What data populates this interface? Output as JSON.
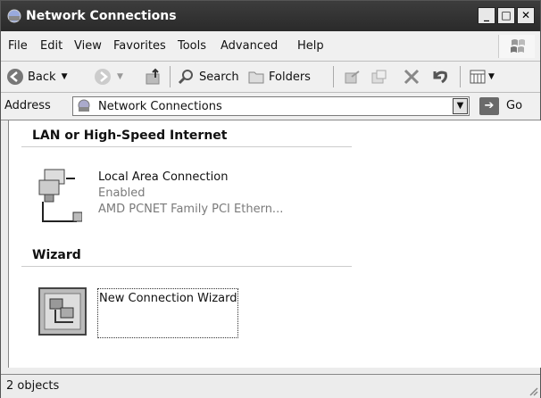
{
  "window": {
    "title": "Network Connections"
  },
  "menu": [
    {
      "label": "File"
    },
    {
      "label": "Edit"
    },
    {
      "label": "View"
    },
    {
      "label": "Favorites"
    },
    {
      "label": "Tools"
    },
    {
      "label": "Advanced"
    },
    {
      "label": "Help"
    }
  ],
  "toolbar": {
    "back": "Back",
    "search": "Search",
    "folders": "Folders"
  },
  "address": {
    "label": "Address",
    "value": "Network Connections",
    "go": "Go"
  },
  "groups": {
    "lan": {
      "header": "LAN or High-Speed Internet",
      "item": {
        "name": "Local Area Connection",
        "status": "Enabled",
        "device": "AMD PCNET Family PCI Ethern..."
      }
    },
    "wizard": {
      "header": "Wizard",
      "item": {
        "name": "New Connection Wizard"
      }
    }
  },
  "status": {
    "text": "2 objects"
  }
}
